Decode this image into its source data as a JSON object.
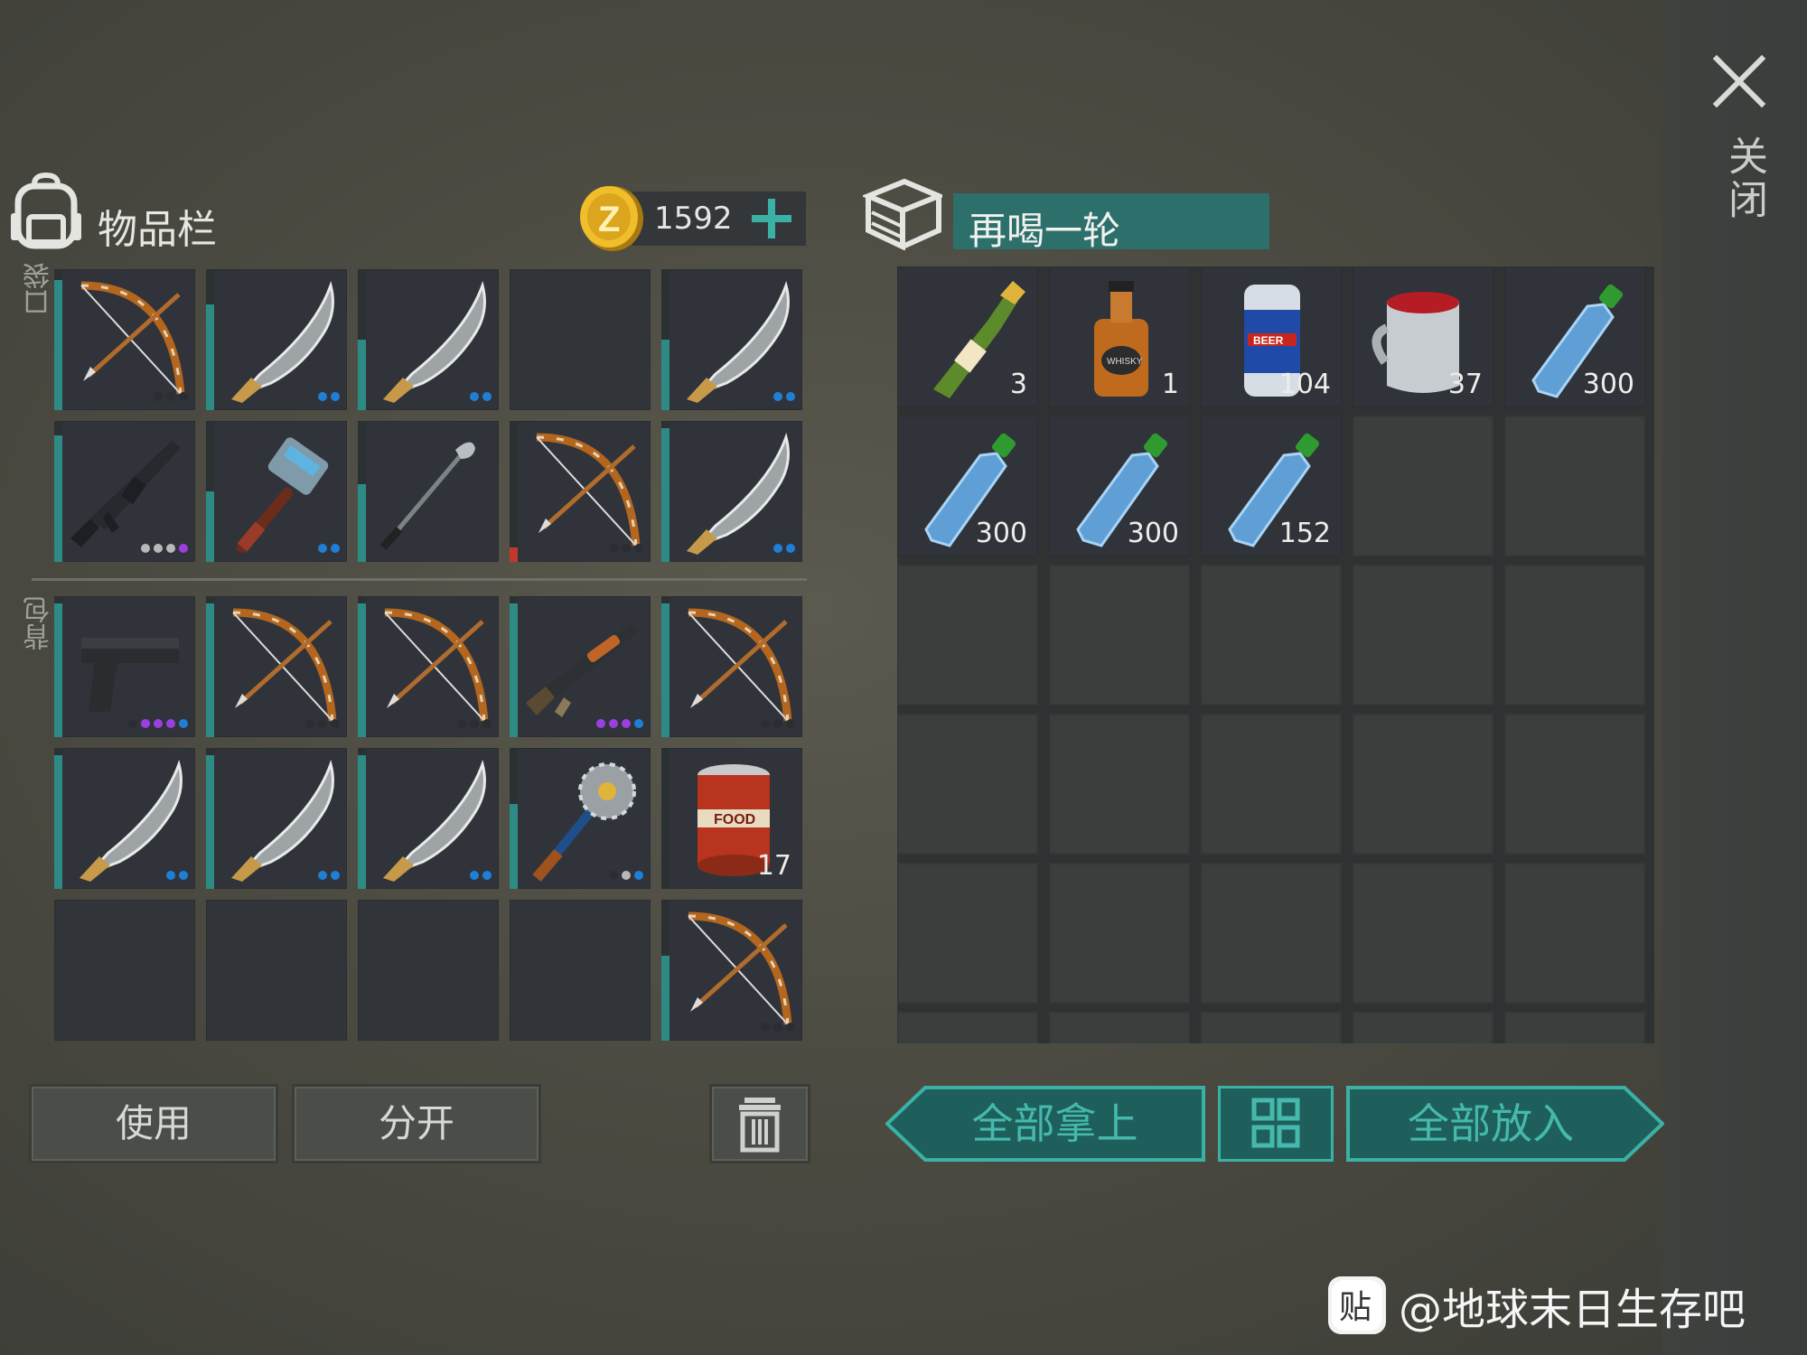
{
  "close_label": "关闭",
  "inventory": {
    "title": "物品栏",
    "coins": "1592",
    "pocket_label": "口袋",
    "backpack_label": "背包",
    "pocket_slots": [
      {
        "icon": "bow-icon",
        "dots": [
          "#2a2d31",
          "#2a2d31",
          "#2a2d31"
        ],
        "bar": 0.92
      },
      {
        "icon": "machete-icon",
        "dots": [
          "#1f7fd6",
          "#1f7fd6"
        ],
        "bar": 0.75
      },
      {
        "icon": "machete-icon",
        "dots": [
          "#1f7fd6",
          "#1f7fd6"
        ],
        "bar": 0.5
      },
      {
        "icon": "",
        "dots": [],
        "bar": 0
      },
      {
        "icon": "machete-icon",
        "dots": [
          "#1f7fd6",
          "#1f7fd6"
        ],
        "bar": 0.5
      },
      {
        "icon": "rifle-icon",
        "dots": [
          "#b8b8b8",
          "#b8b8b8",
          "#b8b8b8",
          "#9b3fe0"
        ],
        "bar": 0.9
      },
      {
        "icon": "hammer-icon",
        "dots": [
          "#1f7fd6",
          "#1f7fd6"
        ],
        "bar": 0.5
      },
      {
        "icon": "golf-club-icon",
        "dots": [],
        "bar": 0.55
      },
      {
        "icon": "bow-icon",
        "dots": [
          "#2a2d31",
          "#2a2d31",
          "#2a2d31"
        ],
        "bar": 0.1,
        "bar_color": "#c0392b"
      },
      {
        "icon": "machete-icon",
        "dots": [
          "#1f7fd6",
          "#1f7fd6"
        ],
        "bar": 0.95
      }
    ],
    "backpack_slots": [
      {
        "icon": "pistol-icon",
        "dots": [
          "#2a2d31",
          "#9b3fe0",
          "#9b3fe0",
          "#9b3fe0",
          "#1f7fd6"
        ],
        "bar": 0.95
      },
      {
        "icon": "bow-icon",
        "dots": [
          "#2a2d31",
          "#2a2d31",
          "#2a2d31"
        ],
        "bar": 0.95
      },
      {
        "icon": "bow-icon",
        "dots": [
          "#2a2d31",
          "#2a2d31",
          "#2a2d31"
        ],
        "bar": 0.95
      },
      {
        "icon": "shotgun-icon",
        "dots": [
          "#9b3fe0",
          "#9b3fe0",
          "#9b3fe0",
          "#1f7fd6"
        ],
        "bar": 0.95
      },
      {
        "icon": "bow-icon",
        "dots": [
          "#2a2d31",
          "#2a2d31",
          "#2a2d31"
        ],
        "bar": 0.95
      },
      {
        "icon": "machete-icon",
        "dots": [
          "#1f7fd6",
          "#1f7fd6"
        ],
        "bar": 0.95
      },
      {
        "icon": "machete-icon",
        "dots": [
          "#1f7fd6",
          "#1f7fd6"
        ],
        "bar": 0.95
      },
      {
        "icon": "machete-icon",
        "dots": [
          "#1f7fd6",
          "#1f7fd6"
        ],
        "bar": 0.95
      },
      {
        "icon": "saw-mace-icon",
        "dots": [
          "#2a2d31",
          "#b8b8b8",
          "#1f7fd6"
        ],
        "bar": 0.6
      },
      {
        "icon": "food-can-icon",
        "qty": "17",
        "dots": [],
        "bar": 0
      },
      {
        "icon": "",
        "dots": [],
        "bar": 0
      },
      {
        "icon": "",
        "dots": [],
        "bar": 0
      },
      {
        "icon": "",
        "dots": [],
        "bar": 0
      },
      {
        "icon": "",
        "dots": [],
        "bar": 0
      },
      {
        "icon": "bow-icon",
        "dots": [
          "#2a2d31",
          "#2a2d31",
          "#2a2d31"
        ],
        "bar": 0.6
      }
    ],
    "use_label": "使用",
    "split_label": "分开"
  },
  "container": {
    "title": "再喝一轮",
    "items": [
      {
        "icon": "champagne-icon",
        "qty": "3"
      },
      {
        "icon": "whiskey-icon",
        "qty": "1"
      },
      {
        "icon": "beer-can-icon",
        "qty": "104"
      },
      {
        "icon": "mug-icon",
        "qty": "37"
      },
      {
        "icon": "water-bottle-icon",
        "qty": "300"
      },
      {
        "icon": "water-bottle-icon",
        "qty": "300"
      },
      {
        "icon": "water-bottle-icon",
        "qty": "300"
      },
      {
        "icon": "water-bottle-icon",
        "qty": "152"
      }
    ],
    "take_all_label": "全部拿上",
    "put_all_label": "全部放入"
  },
  "watermark": "@地球末日生存吧",
  "colors": {
    "accent": "#3bb1a6",
    "teal_dark": "#1f5f5b",
    "panel": "#30343a"
  }
}
